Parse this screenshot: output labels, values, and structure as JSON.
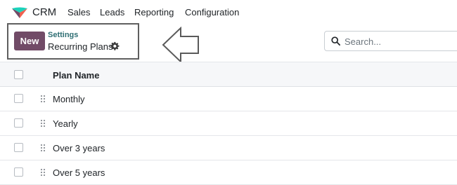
{
  "navbar": {
    "app_name": "CRM",
    "menu": [
      "Sales",
      "Leads",
      "Reporting",
      "Configuration"
    ]
  },
  "control_panel": {
    "new_label": "New",
    "breadcrumb_parent": "Settings",
    "breadcrumb_current": "Recurring Plans"
  },
  "search": {
    "placeholder": "Search..."
  },
  "table": {
    "header": "Plan Name",
    "rows": [
      "Monthly",
      "Yearly",
      "Over 3 years",
      "Over 5 years"
    ]
  },
  "colors": {
    "brand": "#714b67",
    "link": "#2e6e73",
    "logo_green": "#1ad3bb",
    "logo_purple": "#714b67"
  }
}
